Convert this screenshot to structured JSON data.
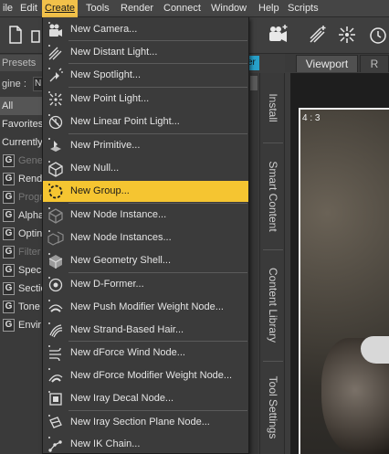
{
  "menubar": {
    "items": [
      "ile",
      "Edit",
      "Create",
      "Tools",
      "Render",
      "Connect",
      "Window",
      "Help",
      "Scripts"
    ],
    "active": "Create"
  },
  "left_panel": {
    "tab": "Presets",
    "engine_label": "gine :",
    "engine_value": "N",
    "rows": [
      "All",
      "Favorites",
      "Currently"
    ],
    "items": [
      {
        "badge": "G",
        "label": "Gene",
        "dim": true
      },
      {
        "badge": "G",
        "label": "Rend",
        "dim": false
      },
      {
        "badge": "G",
        "label": "Progr",
        "dim": true
      },
      {
        "badge": "G",
        "label": "Alpha",
        "dim": false
      },
      {
        "badge": "G",
        "label": "Optin",
        "dim": false
      },
      {
        "badge": "G",
        "label": "Filter",
        "dim": true
      },
      {
        "badge": "G",
        "label": "Spec",
        "dim": false
      },
      {
        "badge": "G",
        "label": "Sectio",
        "dim": false
      },
      {
        "badge": "G",
        "label": "Tone",
        "dim": false
      },
      {
        "badge": "G",
        "label": "Envir",
        "dim": false
      }
    ]
  },
  "create_menu": {
    "items": [
      {
        "label": "New Camera...",
        "icon": "camera-icon"
      },
      {
        "label": "New Distant Light...",
        "icon": "distant-light-icon"
      },
      {
        "label": "New Spotlight...",
        "icon": "spotlight-icon"
      },
      {
        "label": "New Point Light...",
        "icon": "point-light-icon"
      },
      {
        "label": "New Linear Point Light...",
        "icon": "linear-point-light-icon"
      },
      {
        "label": "New Primitive...",
        "icon": "primitive-icon"
      },
      {
        "label": "New Null...",
        "icon": "null-icon"
      },
      {
        "label": "New Group...",
        "icon": "group-icon",
        "selected": true
      },
      {
        "label": "New Node Instance...",
        "icon": "node-instance-icon"
      },
      {
        "label": "New Node Instances...",
        "icon": "node-instances-icon"
      },
      {
        "label": "New Geometry Shell...",
        "icon": "geometry-shell-icon"
      },
      {
        "label": "New D-Former...",
        "icon": "dformer-icon"
      },
      {
        "label": "New Push Modifier Weight Node...",
        "icon": "push-modifier-icon"
      },
      {
        "label": "New Strand-Based Hair...",
        "icon": "strand-hair-icon"
      },
      {
        "label": "New dForce Wind Node...",
        "icon": "dforce-wind-icon"
      },
      {
        "label": "New dForce Modifier Weight Node...",
        "icon": "dforce-modifier-icon"
      },
      {
        "label": "New Iray Decal Node...",
        "icon": "iray-decal-icon"
      },
      {
        "label": "New Iray Section Plane Node...",
        "icon": "iray-section-plane-icon"
      },
      {
        "label": "New IK Chain...",
        "icon": "ik-chain-icon"
      }
    ]
  },
  "side_tabs": [
    "Install",
    "Smart Content",
    "Content Library",
    "Tool Settings"
  ],
  "viewport": {
    "tabs": [
      "Viewport",
      "R"
    ],
    "aspect_label": "4 : 3"
  },
  "stub_tab": "er",
  "colors": {
    "menu_highlight": "#f5c531",
    "menubar_active": "#f2c14a",
    "accent_tab": "#27a0c9"
  }
}
